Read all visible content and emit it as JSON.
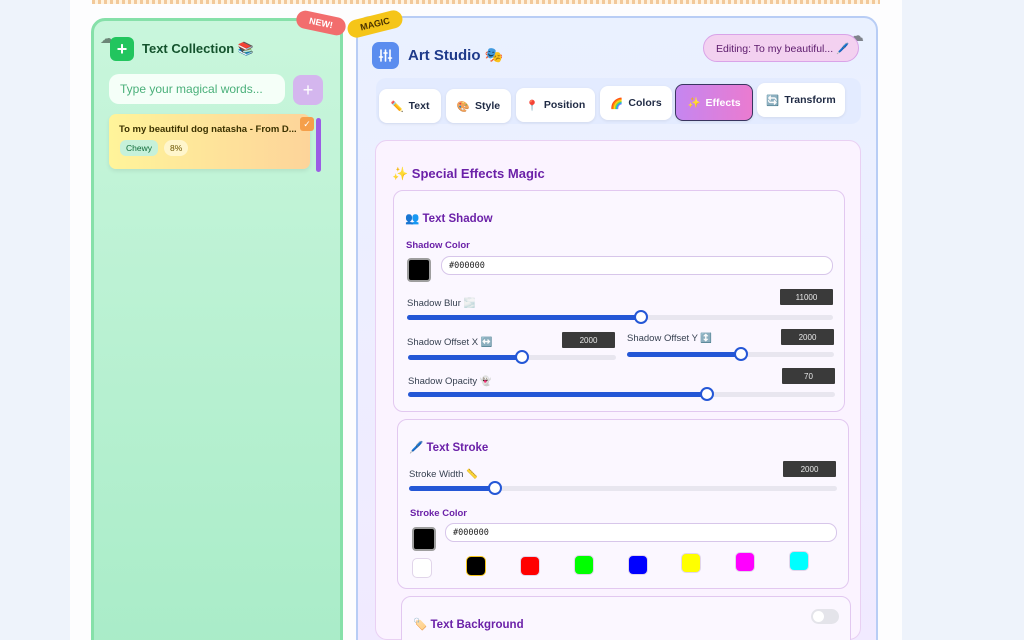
{
  "badges": {
    "new": "NEW!",
    "magic": "MAGIC"
  },
  "collection": {
    "title": "Text Collection 📚",
    "add_icon": "+",
    "input_placeholder": "Type your magical words...",
    "add_button": "+",
    "items": [
      {
        "title": "To my beautiful dog natasha - From D...",
        "font": "Chewy",
        "percent": "8%",
        "checked": "✓"
      }
    ]
  },
  "studio": {
    "title": "Art Studio 🎭",
    "icon": "sliders-icon",
    "editing": "Editing: To my beautiful... 🖊️",
    "tabs": [
      {
        "label": "Text",
        "icon": "✏️"
      },
      {
        "label": "Style",
        "icon": "🎨"
      },
      {
        "label": "Position",
        "icon": "📍"
      },
      {
        "label": "Colors",
        "icon": "🌈"
      },
      {
        "label": "Effects",
        "icon": "✨"
      },
      {
        "label": "Transform",
        "icon": "🔄"
      }
    ],
    "active_tab": "Effects"
  },
  "effects": {
    "title": "✨ Special Effects Magic",
    "shadow": {
      "title": "👥 Text Shadow",
      "color_label": "Shadow Color",
      "color_value": "#000000",
      "blur_label": "Shadow Blur 🌫️",
      "blur_value": "11000",
      "blur_level": 0.55,
      "offset_x_label": "Shadow Offset X ↔️",
      "offset_x_value": "2000",
      "offset_x_level": 0.55,
      "offset_y_label": "Shadow Offset Y ↕️",
      "offset_y_value": "2000",
      "offset_y_level": 0.55,
      "opacity_label": "Shadow Opacity 👻",
      "opacity_value": "70",
      "opacity_level": 0.7
    },
    "stroke": {
      "title": "🖊️ Text Stroke",
      "width_label": "Stroke Width 📏",
      "width_value": "2000",
      "width_level": 0.2,
      "color_label": "Stroke Color",
      "color_value": "#000000",
      "palette": [
        "#ffffff",
        "#000000",
        "#ff0000",
        "#00ff00",
        "#0000ff",
        "#ffff00",
        "#ff00ff",
        "#00ffff"
      ]
    },
    "background": {
      "title": "🏷️ Text Background",
      "enabled": false
    }
  }
}
